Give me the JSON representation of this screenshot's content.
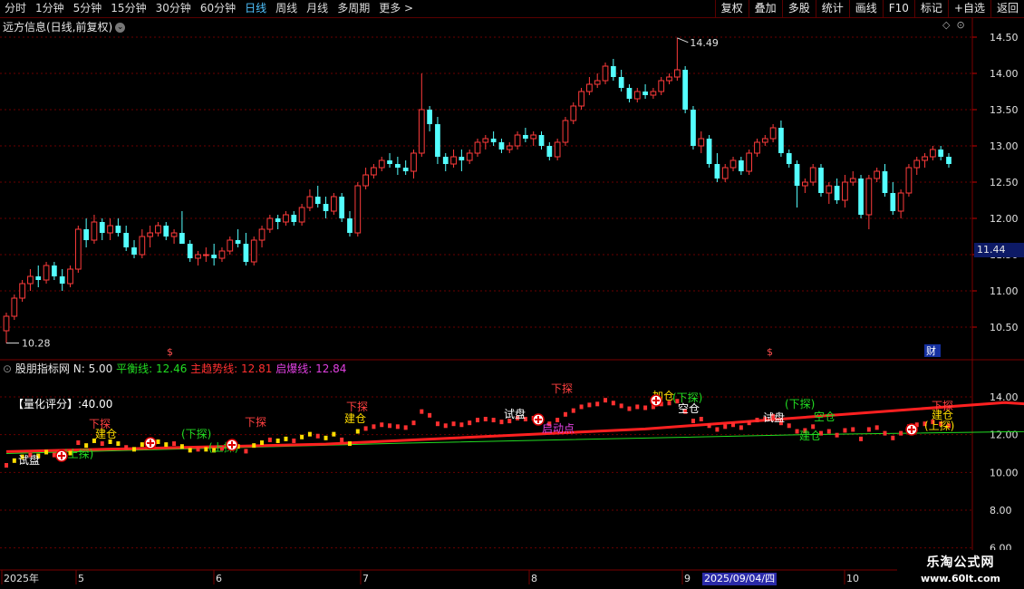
{
  "toolbar": {
    "periods": [
      {
        "label": "分时",
        "active": false
      },
      {
        "label": "1分钟",
        "active": false
      },
      {
        "label": "5分钟",
        "active": false
      },
      {
        "label": "15分钟",
        "active": false
      },
      {
        "label": "30分钟",
        "active": false
      },
      {
        "label": "60分钟",
        "active": false
      },
      {
        "label": "日线",
        "active": true
      },
      {
        "label": "周线",
        "active": false
      },
      {
        "label": "月线",
        "active": false
      },
      {
        "label": "多周期",
        "active": false
      },
      {
        "label": "更多 >",
        "active": false
      }
    ],
    "tools": [
      "复权",
      "叠加",
      "多股",
      "统计",
      "画线",
      "F10",
      "标记",
      "+自选",
      "返回"
    ]
  },
  "main": {
    "title": "远方信息(日线,前复权)",
    "current_price": "11.44",
    "high_label": "14.49",
    "low_label": "10.28",
    "markers": [
      "$",
      "$",
      "财"
    ]
  },
  "indicator": {
    "name": "股朋指标网",
    "n": "N: 5.00",
    "balance": "平衡线: 12.46",
    "trend": "主趋势线: 12.81",
    "burst": "启爆线: 12.84",
    "score": "【量化评分】:40.00"
  },
  "chart_data": [
    {
      "type": "candlestick",
      "title": "远方信息(日线,前复权)",
      "y_ticks": [
        "14.50",
        "14.00",
        "13.50",
        "13.00",
        "12.50",
        "12.00",
        "11.50",
        "11.00",
        "10.50"
      ],
      "ylim": [
        10.2,
        14.7
      ],
      "high": 14.49,
      "low": 10.28,
      "x_ticks": [
        "2025年",
        "5",
        "6",
        "7",
        "8",
        "9",
        "2025/09/04/四",
        "10"
      ],
      "ohlc": [
        [
          10.45,
          10.7,
          10.28,
          10.65
        ],
        [
          10.65,
          10.95,
          10.6,
          10.9
        ],
        [
          10.9,
          11.15,
          10.85,
          11.1
        ],
        [
          11.1,
          11.3,
          11.0,
          11.2
        ],
        [
          11.2,
          11.35,
          11.05,
          11.15
        ],
        [
          11.15,
          11.4,
          11.1,
          11.35
        ],
        [
          11.35,
          11.4,
          11.15,
          11.2
        ],
        [
          11.2,
          11.3,
          11.0,
          11.1
        ],
        [
          11.1,
          11.35,
          11.05,
          11.3
        ],
        [
          11.3,
          11.9,
          11.25,
          11.85
        ],
        [
          11.85,
          12.0,
          11.6,
          11.7
        ],
        [
          11.7,
          12.05,
          11.65,
          11.95
        ],
        [
          11.95,
          12.0,
          11.7,
          11.8
        ],
        [
          11.8,
          12.0,
          11.7,
          11.9
        ],
        [
          11.9,
          12.0,
          11.75,
          11.8
        ],
        [
          11.8,
          11.9,
          11.55,
          11.6
        ],
        [
          11.6,
          11.7,
          11.45,
          11.5
        ],
        [
          11.5,
          11.85,
          11.45,
          11.75
        ],
        [
          11.75,
          11.9,
          11.6,
          11.8
        ],
        [
          11.8,
          11.95,
          11.75,
          11.9
        ],
        [
          11.9,
          11.95,
          11.7,
          11.75
        ],
        [
          11.75,
          11.85,
          11.65,
          11.8
        ],
        [
          11.8,
          12.1,
          11.7,
          11.65
        ],
        [
          11.65,
          11.7,
          11.4,
          11.45
        ],
        [
          11.45,
          11.55,
          11.35,
          11.5
        ],
        [
          11.5,
          11.6,
          11.4,
          11.5
        ],
        [
          11.5,
          11.65,
          11.35,
          11.45
        ],
        [
          11.45,
          11.6,
          11.4,
          11.55
        ],
        [
          11.55,
          11.75,
          11.5,
          11.7
        ],
        [
          11.7,
          11.85,
          11.6,
          11.65
        ],
        [
          11.65,
          11.8,
          11.35,
          11.4
        ],
        [
          11.4,
          11.75,
          11.35,
          11.7
        ],
        [
          11.7,
          11.9,
          11.6,
          11.85
        ],
        [
          11.85,
          12.05,
          11.8,
          12.0
        ],
        [
          12.0,
          12.05,
          11.85,
          11.95
        ],
        [
          11.95,
          12.1,
          11.9,
          12.05
        ],
        [
          12.05,
          12.1,
          11.9,
          11.95
        ],
        [
          11.95,
          12.2,
          11.9,
          12.15
        ],
        [
          12.15,
          12.4,
          12.1,
          12.3
        ],
        [
          12.3,
          12.45,
          12.15,
          12.2
        ],
        [
          12.2,
          12.3,
          12.0,
          12.1
        ],
        [
          12.1,
          12.35,
          12.05,
          12.3
        ],
        [
          12.3,
          12.35,
          11.95,
          12.0
        ],
        [
          12.0,
          12.1,
          11.75,
          11.8
        ],
        [
          11.8,
          12.5,
          11.75,
          12.45
        ],
        [
          12.45,
          12.7,
          12.4,
          12.6
        ],
        [
          12.6,
          12.75,
          12.55,
          12.7
        ],
        [
          12.7,
          12.85,
          12.65,
          12.8
        ],
        [
          12.8,
          12.9,
          12.7,
          12.75
        ],
        [
          12.75,
          12.85,
          12.6,
          12.7
        ],
        [
          12.7,
          12.8,
          12.6,
          12.65
        ],
        [
          12.65,
          12.95,
          12.55,
          12.9
        ],
        [
          12.9,
          14.0,
          12.85,
          13.5
        ],
        [
          13.5,
          13.55,
          13.2,
          13.3
        ],
        [
          13.3,
          13.4,
          12.75,
          12.85
        ],
        [
          12.85,
          12.9,
          12.65,
          12.75
        ],
        [
          12.75,
          12.95,
          12.7,
          12.85
        ],
        [
          12.85,
          12.95,
          12.65,
          12.8
        ],
        [
          12.8,
          12.95,
          12.75,
          12.9
        ],
        [
          12.9,
          13.1,
          12.85,
          13.05
        ],
        [
          13.05,
          13.15,
          12.95,
          13.1
        ],
        [
          13.1,
          13.2,
          13.0,
          13.05
        ],
        [
          13.05,
          13.1,
          12.9,
          12.95
        ],
        [
          12.95,
          13.05,
          12.9,
          13.0
        ],
        [
          13.0,
          13.2,
          12.95,
          13.15
        ],
        [
          13.15,
          13.25,
          13.05,
          13.1
        ],
        [
          13.1,
          13.2,
          13.0,
          13.15
        ],
        [
          13.15,
          13.2,
          12.95,
          13.0
        ],
        [
          13.0,
          13.05,
          12.8,
          12.85
        ],
        [
          12.85,
          13.1,
          12.8,
          13.05
        ],
        [
          13.05,
          13.4,
          13.0,
          13.35
        ],
        [
          13.35,
          13.6,
          13.3,
          13.55
        ],
        [
          13.55,
          13.8,
          13.5,
          13.75
        ],
        [
          13.75,
          13.95,
          13.7,
          13.85
        ],
        [
          13.85,
          14.0,
          13.8,
          13.9
        ],
        [
          13.9,
          14.15,
          13.85,
          14.1
        ],
        [
          14.1,
          14.2,
          13.9,
          13.95
        ],
        [
          13.95,
          14.05,
          13.75,
          13.8
        ],
        [
          13.8,
          13.85,
          13.6,
          13.65
        ],
        [
          13.65,
          13.8,
          13.6,
          13.75
        ],
        [
          13.75,
          13.85,
          13.65,
          13.7
        ],
        [
          13.7,
          13.8,
          13.65,
          13.75
        ],
        [
          13.75,
          13.95,
          13.7,
          13.9
        ],
        [
          13.9,
          14.0,
          13.85,
          13.95
        ],
        [
          13.95,
          14.49,
          13.9,
          14.05
        ],
        [
          14.05,
          14.1,
          13.45,
          13.5
        ],
        [
          13.5,
          13.55,
          12.95,
          13.0
        ],
        [
          13.0,
          13.2,
          12.9,
          13.1
        ],
        [
          13.1,
          13.15,
          12.7,
          12.75
        ],
        [
          12.75,
          12.9,
          12.5,
          12.55
        ],
        [
          12.55,
          12.75,
          12.5,
          12.7
        ],
        [
          12.7,
          12.85,
          12.65,
          12.8
        ],
        [
          12.8,
          12.85,
          12.6,
          12.65
        ],
        [
          12.65,
          12.95,
          12.6,
          12.9
        ],
        [
          12.9,
          13.1,
          12.85,
          13.05
        ],
        [
          13.05,
          13.15,
          13.0,
          13.1
        ],
        [
          13.1,
          13.3,
          13.05,
          13.25
        ],
        [
          13.25,
          13.35,
          12.85,
          12.9
        ],
        [
          12.9,
          12.95,
          12.7,
          12.75
        ],
        [
          12.75,
          12.8,
          12.15,
          12.45
        ],
        [
          12.45,
          12.55,
          12.35,
          12.5
        ],
        [
          12.5,
          12.75,
          12.45,
          12.7
        ],
        [
          12.7,
          12.75,
          12.3,
          12.35
        ],
        [
          12.35,
          12.5,
          12.2,
          12.45
        ],
        [
          12.45,
          12.55,
          12.2,
          12.25
        ],
        [
          12.25,
          12.6,
          12.15,
          12.5
        ],
        [
          12.5,
          12.65,
          12.45,
          12.55
        ],
        [
          12.55,
          12.6,
          12.0,
          12.05
        ],
        [
          12.05,
          12.6,
          11.85,
          12.55
        ],
        [
          12.55,
          12.7,
          12.5,
          12.65
        ],
        [
          12.65,
          12.75,
          12.3,
          12.35
        ],
        [
          12.35,
          12.5,
          12.05,
          12.1
        ],
        [
          12.1,
          12.4,
          12.0,
          12.35
        ],
        [
          12.35,
          12.75,
          12.3,
          12.7
        ],
        [
          12.7,
          12.85,
          12.6,
          12.8
        ],
        [
          12.8,
          12.9,
          12.7,
          12.85
        ],
        [
          12.85,
          13.0,
          12.8,
          12.95
        ],
        [
          12.95,
          13.0,
          12.8,
          12.85
        ],
        [
          12.85,
          12.9,
          12.7,
          12.75
        ]
      ]
    },
    {
      "type": "line",
      "title": "股朋指标网",
      "y_ticks": [
        "14.00",
        "12.00",
        "10.00",
        "8.00",
        "6.00"
      ],
      "ylim": [
        5.0,
        15.7
      ],
      "series": [
        {
          "name": "平衡线",
          "color": "#22dd22",
          "x": [
            0,
            50,
            100,
            150,
            204
          ],
          "y": [
            11.0,
            11.55,
            12.0,
            12.3,
            12.46
          ]
        },
        {
          "name": "主趋势线",
          "color": "#ff2020",
          "x": [
            0,
            40,
            80,
            125,
            150,
            204
          ],
          "y": [
            11.1,
            11.5,
            12.3,
            13.7,
            13.0,
            12.81
          ]
        },
        {
          "name": "启爆线",
          "color": "#dd33dd",
          "x": [
            140,
            204
          ],
          "y": [
            12.9,
            12.84
          ]
        }
      ],
      "annotations": [
        "试盘",
        "(上探)",
        "下探",
        "建仓",
        "(下探)",
        "(上探)",
        "加仓",
        "启动点",
        "空仓"
      ]
    }
  ]
}
